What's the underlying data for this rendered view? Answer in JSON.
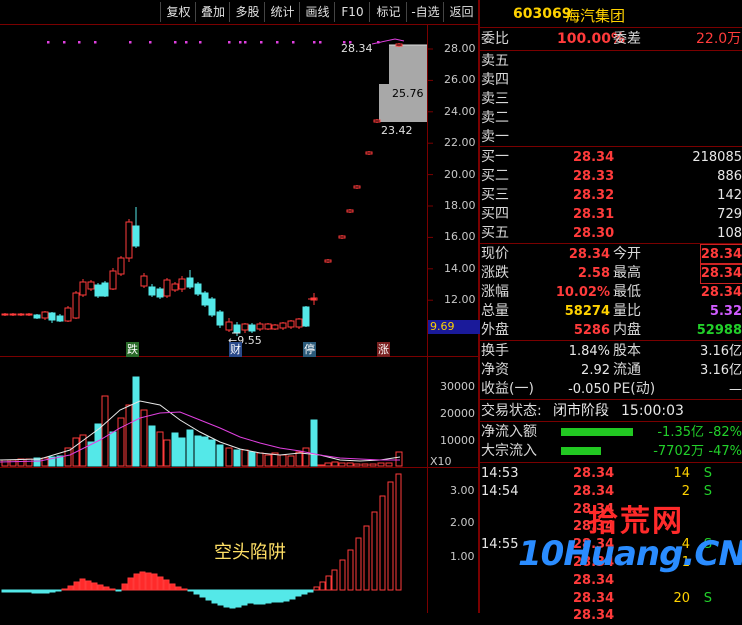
{
  "toolbar": {
    "buttons": [
      "复权",
      "叠加",
      "多股",
      "统计",
      "画线",
      "F10",
      "标记",
      "-自选",
      "返回"
    ]
  },
  "price_axis": [
    "28.00",
    "26.00",
    "24.00",
    "22.00",
    "20.00",
    "18.00",
    "16.00",
    "14.00",
    "12.00"
  ],
  "last_price_tag": "9.69",
  "high_annotation": "28.34",
  "low_annotation": "9.55",
  "box_labels": {
    "mid": "25.76",
    "low": "23.42"
  },
  "event_tags": {
    "die": "跌",
    "cai": "财",
    "ting": "停",
    "zhang": "涨"
  },
  "volume_axis": [
    "30000",
    "20000",
    "10000"
  ],
  "volume_unit": "X10",
  "macd_axis": [
    "3.00",
    "2.00",
    "1.00"
  ],
  "pattern_label": "空头陷阱",
  "stock": {
    "code": "603069",
    "name": "海汽集团"
  },
  "order_ratio": {
    "label1": "委比",
    "value1": "100.00%",
    "label2": "委差",
    "value2": "22.0万"
  },
  "sell_levels": [
    "卖五",
    "卖四",
    "卖三",
    "卖二",
    "卖一"
  ],
  "buy_levels": [
    {
      "label": "买一",
      "price": "28.34",
      "volume": "218085"
    },
    {
      "label": "买二",
      "price": "28.33",
      "volume": "886"
    },
    {
      "label": "买三",
      "price": "28.32",
      "volume": "142"
    },
    {
      "label": "买四",
      "price": "28.31",
      "volume": "729"
    },
    {
      "label": "买五",
      "price": "28.30",
      "volume": "108"
    }
  ],
  "quote": [
    {
      "l1": "现价",
      "v1": "28.34",
      "c1": "red",
      "l2": "今开",
      "v2": "28.34",
      "c2": "red",
      "box2": true
    },
    {
      "l1": "涨跌",
      "v1": "2.58",
      "c1": "red",
      "l2": "最高",
      "v2": "28.34",
      "c2": "red",
      "box2": true
    },
    {
      "l1": "涨幅",
      "v1": "10.02%",
      "c1": "red",
      "l2": "最低",
      "v2": "28.34",
      "c2": "red",
      "box2": false
    },
    {
      "l1": "总量",
      "v1": "58274",
      "c1": "yellow",
      "l2": "量比",
      "v2": "5.32",
      "c2": "purple",
      "box2": false
    },
    {
      "l1": "外盘",
      "v1": "5286",
      "c1": "red",
      "l2": "内盘",
      "v2": "52988",
      "c2": "green",
      "box2": false
    }
  ],
  "fundamentals": [
    {
      "l1": "换手",
      "v1": "1.84%",
      "l2": "股本",
      "v2": "3.16亿"
    },
    {
      "l1": "净资",
      "v1": "2.92",
      "l2": "流通",
      "v2": "3.16亿"
    },
    {
      "l1": "收益(一)",
      "v1": "-0.050",
      "l2": "PE(动)",
      "v2": "—"
    }
  ],
  "trade_status": {
    "label": "交易状态:",
    "value": "闭市阶段",
    "time": "15:00:03"
  },
  "flows": [
    {
      "label": "净流入额",
      "value": "-1.35亿",
      "pct": "-82%"
    },
    {
      "label": "大宗流入",
      "value": "-7702万",
      "pct": "-47%"
    }
  ],
  "ticks": [
    {
      "time": "14:53",
      "price": "28.34",
      "vol": "14",
      "side": "S"
    },
    {
      "time": "14:54",
      "price": "28.34",
      "vol": "2",
      "side": "S"
    },
    {
      "time": "",
      "price": "28.34",
      "vol": "",
      "side": ""
    },
    {
      "time": "",
      "price": "28.34",
      "vol": "",
      "side": ""
    },
    {
      "time": "14:55",
      "price": "28.34",
      "vol": "4",
      "side": "S"
    },
    {
      "time": "",
      "price": "28.34",
      "vol": "1",
      "side": ""
    },
    {
      "time": "",
      "price": "28.34",
      "vol": "",
      "side": ""
    },
    {
      "time": "",
      "price": "28.34",
      "vol": "20",
      "side": "S"
    },
    {
      "time": "",
      "price": "28.34",
      "vol": "",
      "side": ""
    }
  ],
  "watermark": {
    "line1": "拾荒网",
    "line2": "10Huang.CN"
  }
}
